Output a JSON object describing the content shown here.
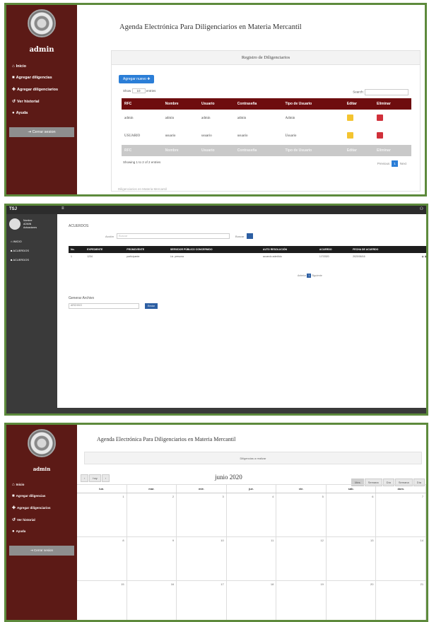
{
  "panel1": {
    "sidebar": {
      "user": "admin",
      "items": [
        {
          "icon": "home-icon",
          "label": "Inicio"
        },
        {
          "icon": "book-icon",
          "label": "Agregar diligencias"
        },
        {
          "icon": "user-plus-icon",
          "label": "Agregar diligenciarios"
        },
        {
          "icon": "history-icon",
          "label": "Ver historial"
        },
        {
          "icon": "info-icon",
          "label": "Ayuda"
        }
      ],
      "logout": "Cerrar sesion"
    },
    "title": "Agenda Electrónica Para Diligenciarios en Materia Mercantil",
    "card_title": "Registro de Diligenciarios",
    "add_button": "Agregar nuevo",
    "show_label": "Show",
    "show_value": "10",
    "entries_label": "entries",
    "search_label": "Search:",
    "columns": [
      "RFC",
      "Nombre",
      "Usuario",
      "Contraseña",
      "Tipo de Usuario",
      "Editar",
      "Eliminar"
    ],
    "rows": [
      [
        "admin",
        "admin",
        "admin",
        "admin",
        "Admin"
      ],
      [
        "USUARIO",
        "usuario",
        "usuario",
        "usuario",
        "Usuario"
      ]
    ],
    "showing": "Showing 1 to 2 of 2 entries",
    "prev": "Previous",
    "page": "1",
    "next": "Next",
    "footer": "Diligenciarios en Materia Mercantil"
  },
  "panel2": {
    "brand": "TSJ",
    "user_name": "Nombre",
    "user_role": "ADMIN",
    "user_sub": "Actuaciones",
    "nav": [
      "INICIO",
      "ACUERDOS",
      "ACUERDOS"
    ],
    "section": "ACUERDOS",
    "search_label": "Acción",
    "search_placeholder": "Buscar",
    "search_btn": "Buscar",
    "columns": [
      "No.",
      "EXPEDIENTE",
      "PROMOVENTE",
      "SERVIDOR PÚBLICO CONCERNIDO",
      "AUTO RESOLUCIÓN",
      "ACUERDO",
      "FECHA DE ACUERDO"
    ],
    "row": [
      "1",
      "1234",
      "participante",
      "Lic. persona",
      "acuerdo admitido",
      "1/7/2020",
      "2020/06/16"
    ],
    "pager": [
      "Anterior",
      "1",
      "Siguiente"
    ],
    "gen_label": "Generar Archivo",
    "gen_select": "ARCHIVO",
    "gen_btn": "Enviar"
  },
  "panel3": {
    "user": "admin",
    "sidebar_items": [
      {
        "icon": "home-icon",
        "label": "Inicio"
      },
      {
        "icon": "book-icon",
        "label": "Agregar diligencias"
      },
      {
        "icon": "user-plus-icon",
        "label": "Agregar diligenciarios"
      },
      {
        "icon": "history-icon",
        "label": "Ver historial"
      },
      {
        "icon": "info-icon",
        "label": "Ayuda"
      }
    ],
    "logout": "Cerrar sesion",
    "title": "Agenda Electrónica Para Diligenciarios en Materia Mercantil",
    "card_title": "Diligencias a realizar",
    "today": "hoy",
    "month": "junio 2020",
    "views": [
      "Mes",
      "Semana",
      "Día",
      "Semana",
      "Día"
    ],
    "days": [
      "lun.",
      "mar.",
      "mié.",
      "jue.",
      "vie.",
      "sáb.",
      "dom."
    ],
    "weeks": [
      [
        "1",
        "2",
        "3",
        "4",
        "5",
        "6",
        "7"
      ],
      [
        "8",
        "9",
        "10",
        "11",
        "12",
        "13",
        "14"
      ],
      [
        "15",
        "16",
        "17",
        "18",
        "19",
        "20",
        "21"
      ]
    ]
  }
}
